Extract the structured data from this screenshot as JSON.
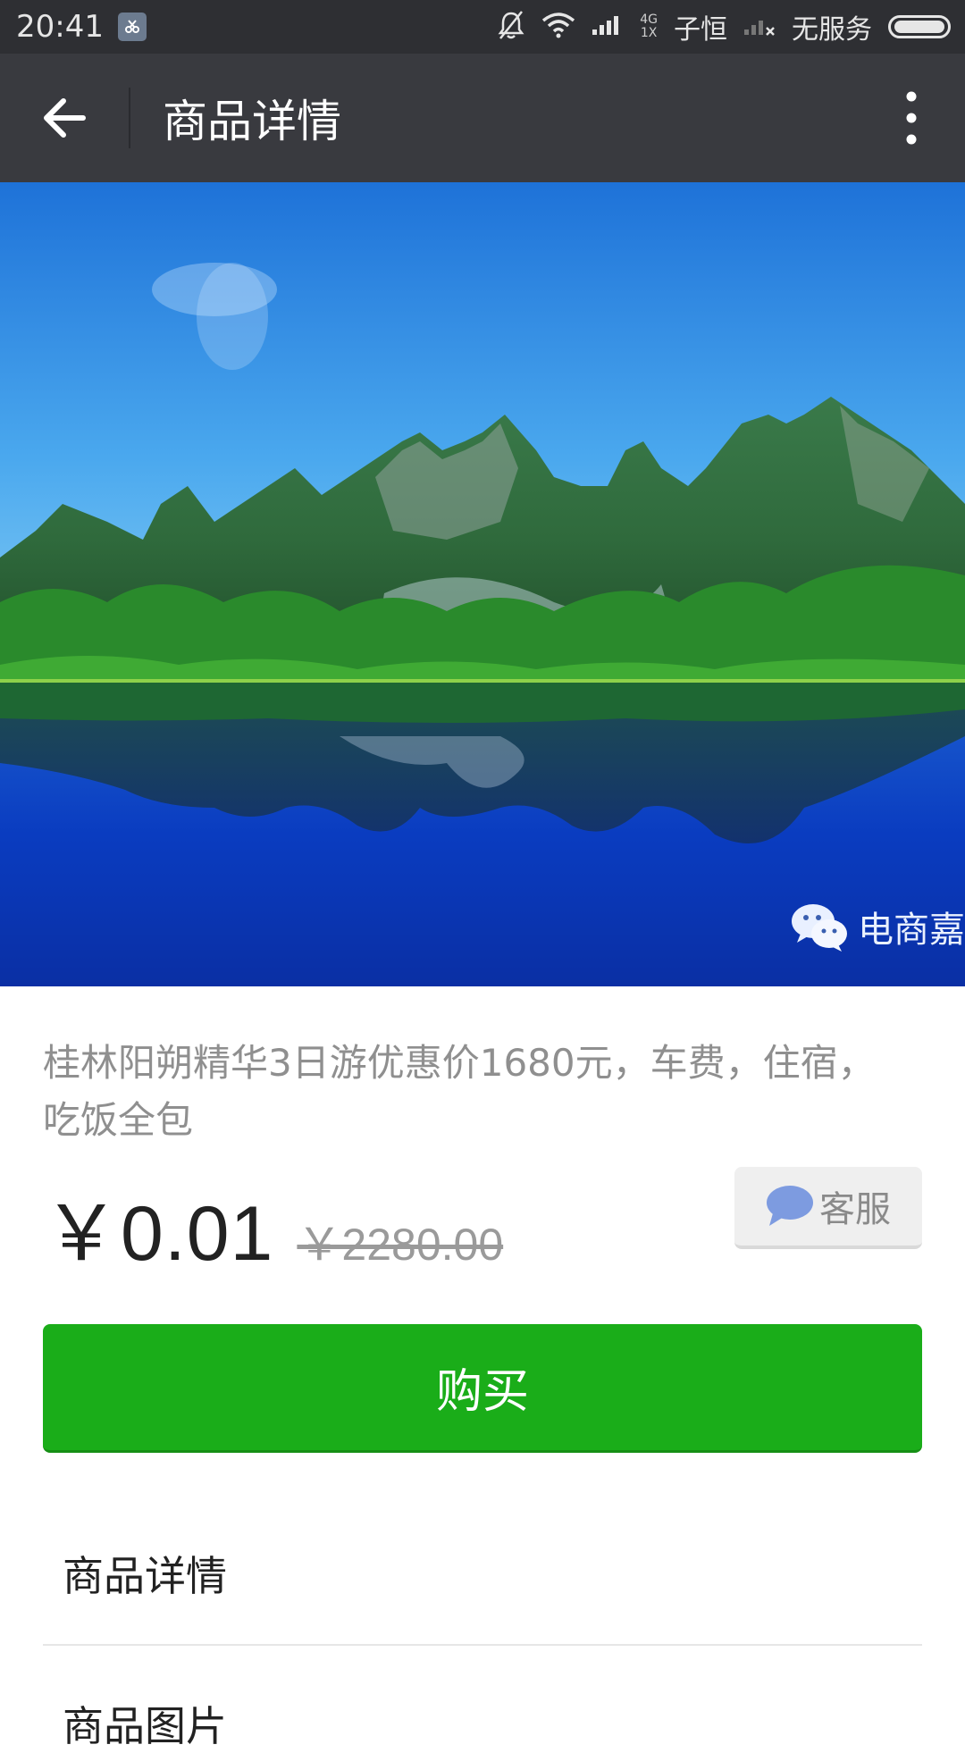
{
  "status_bar": {
    "time": "20:41",
    "network_small": "4G\n1X",
    "carrier": "子恒",
    "service": "无服务",
    "icons": [
      "screenshot-app-icon",
      "bell-off-icon",
      "wifi-icon",
      "signal-icon",
      "no-signal-icon",
      "battery-icon"
    ]
  },
  "app_bar": {
    "title": "商品详情",
    "icons": [
      "back-arrow-icon",
      "more-vertical-icon"
    ]
  },
  "hero": {
    "watermark_text": "电商嘉",
    "watermark_icon": "wechat-icon"
  },
  "product": {
    "description": "桂林阳朔精华3日游优惠价1680元，车费，住宿，吃饭全包",
    "price_current": "￥0.01",
    "price_original": "￥2280.00"
  },
  "customer_service": {
    "label": "客服",
    "icon": "chat-bubble-icon"
  },
  "buy_button": {
    "label": "购买",
    "color": "#1aad19"
  },
  "sections": {
    "details_label": "商品详情",
    "images_label": "商品图片"
  }
}
